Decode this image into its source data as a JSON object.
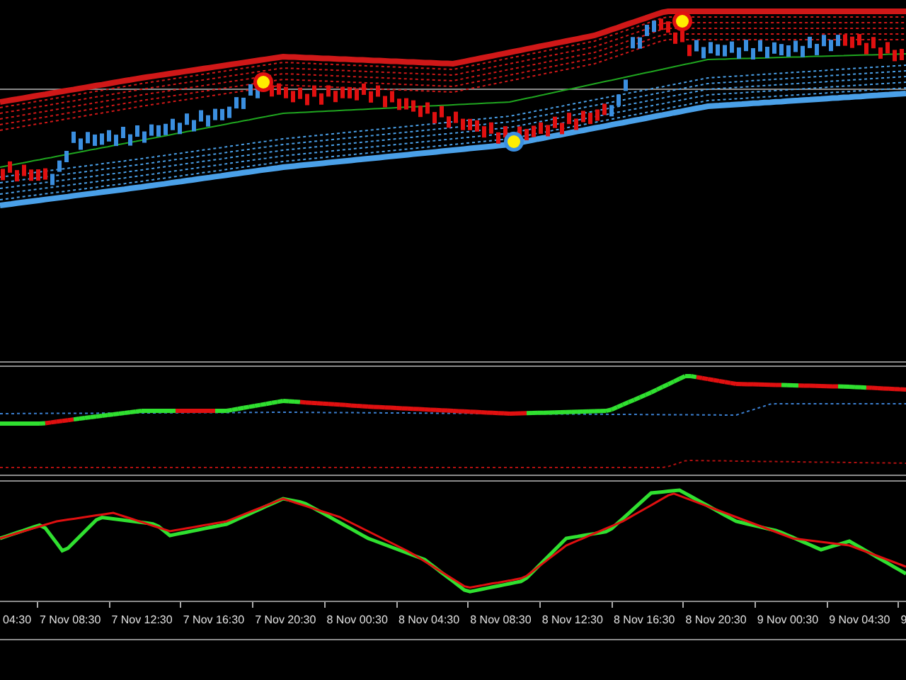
{
  "time_axis": {
    "labels": [
      "04:30",
      "7 Nov 08:30",
      "7 Nov 12:30",
      "7 Nov 16:30",
      "7 Nov 20:30",
      "8 Nov 00:30",
      "8 Nov 04:30",
      "8 Nov 08:30",
      "8 Nov 12:30",
      "8 Nov 16:30",
      "8 Nov 20:30",
      "9 Nov 00:30",
      "9 Nov 04:30",
      "9"
    ]
  }
}
